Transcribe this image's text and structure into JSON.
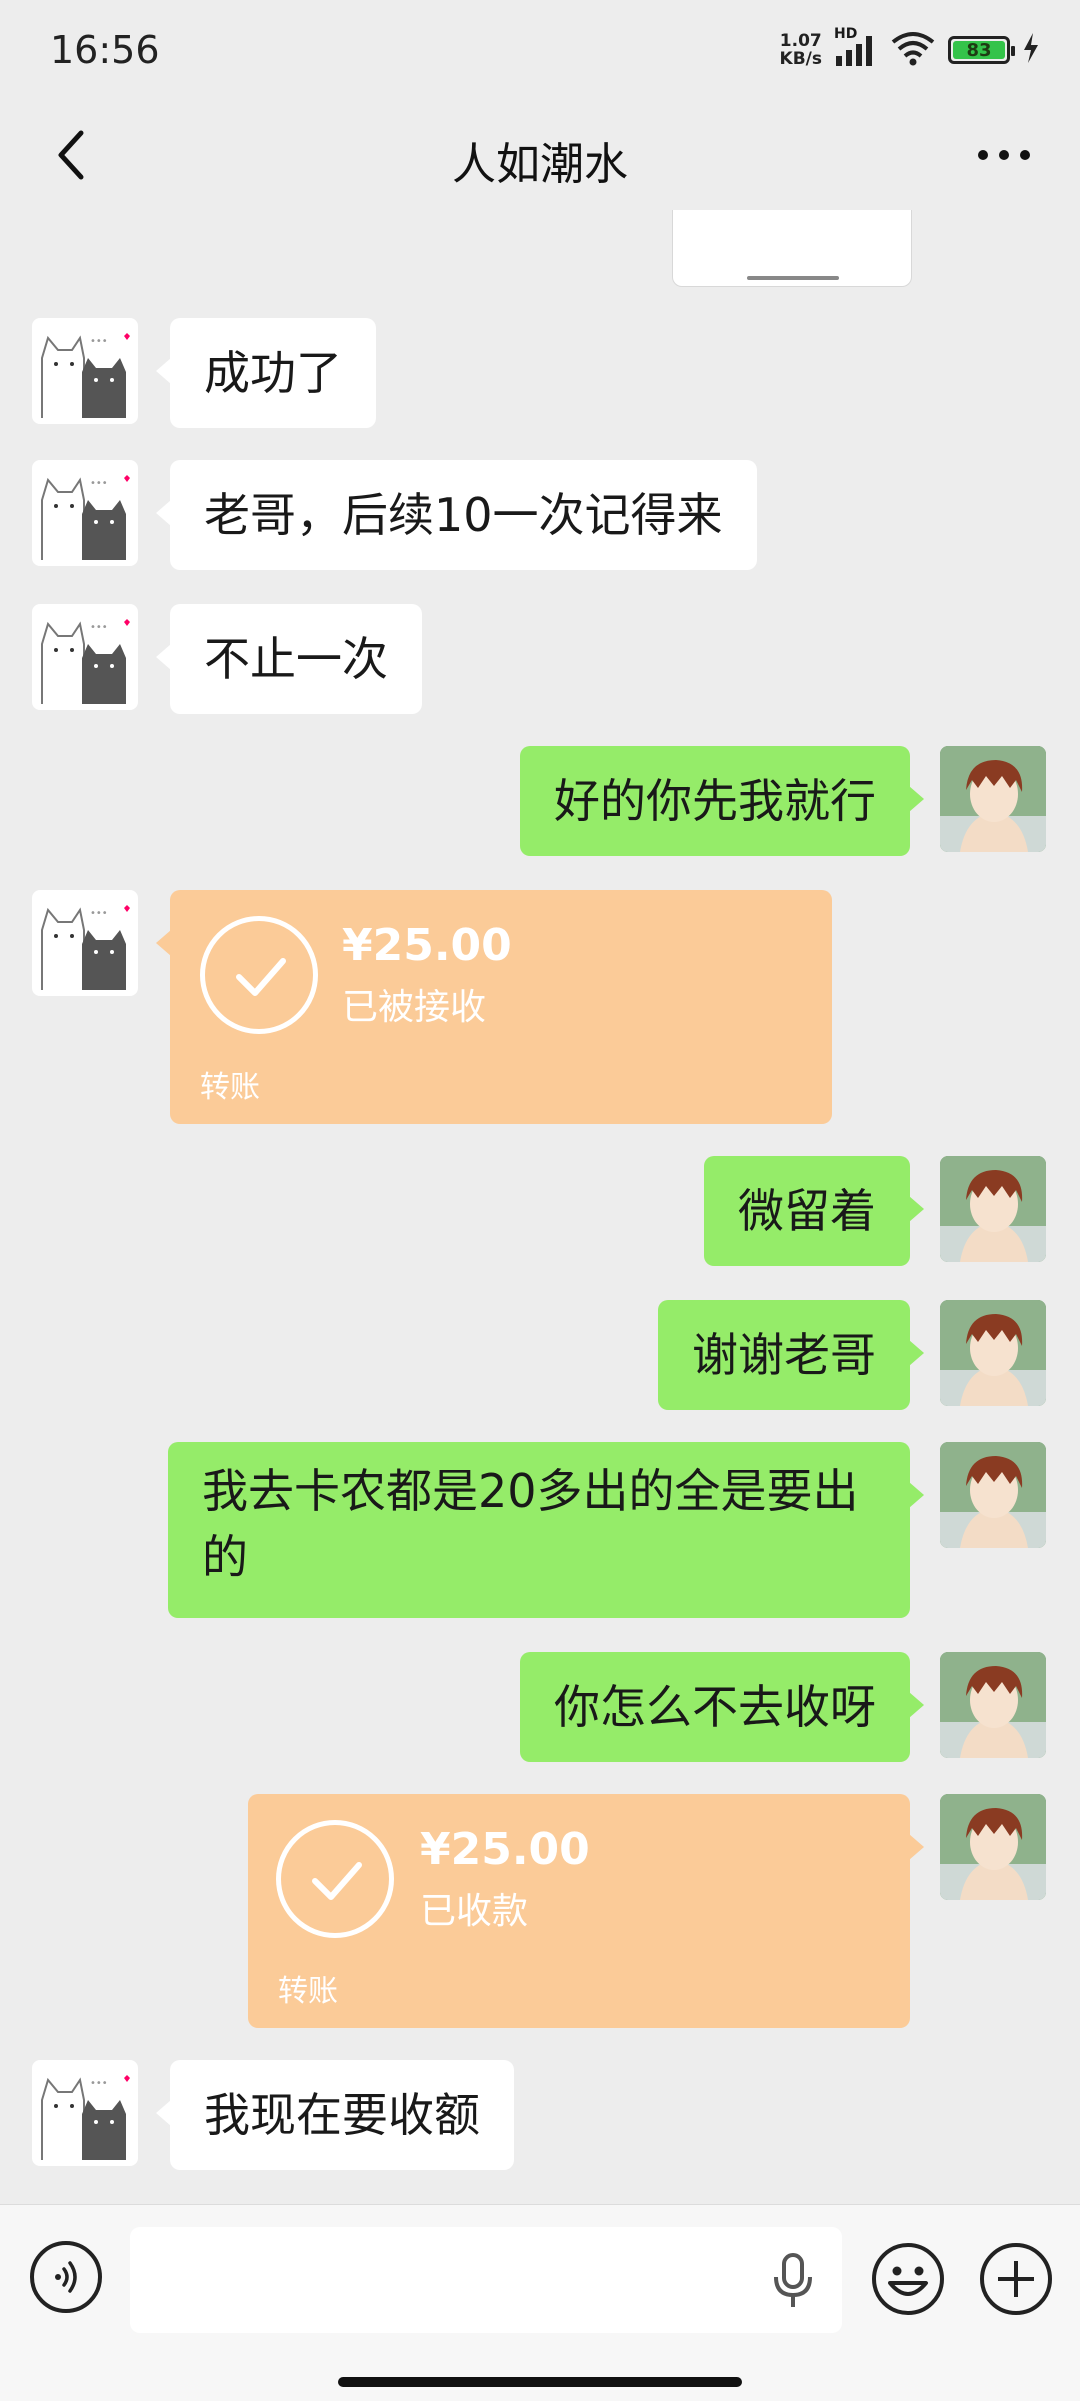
{
  "status_bar": {
    "time": "16:56",
    "net_speed_value": "1.07",
    "net_speed_unit": "KB/s",
    "network_tag": "HD",
    "battery": "83"
  },
  "header": {
    "title": "人如潮水"
  },
  "messages": [
    {
      "sender": "other",
      "type": "text",
      "text": "成功了"
    },
    {
      "sender": "other",
      "type": "text",
      "text": "老哥，后续10一次记得来"
    },
    {
      "sender": "other",
      "type": "text",
      "text": "不止一次"
    },
    {
      "sender": "me",
      "type": "text",
      "text": "好的你先我就行"
    },
    {
      "sender": "other",
      "type": "transfer",
      "amount": "¥25.00",
      "status": "已被接收",
      "label": "转账"
    },
    {
      "sender": "me",
      "type": "text",
      "text": "微留着"
    },
    {
      "sender": "me",
      "type": "text",
      "text": "谢谢老哥"
    },
    {
      "sender": "me",
      "type": "text",
      "text": "我去卡农都是20多出的全是要出的"
    },
    {
      "sender": "me",
      "type": "text",
      "text": "你怎么不去收呀"
    },
    {
      "sender": "me",
      "type": "transfer",
      "amount": "¥25.00",
      "status": "已收款",
      "label": "转账"
    },
    {
      "sender": "other",
      "type": "text",
      "text": "我现在要收额"
    }
  ],
  "input": {
    "value": "",
    "placeholder": ""
  },
  "colors": {
    "background": "#ededed",
    "my_bubble": "#95ec69",
    "other_bubble": "#ffffff",
    "transfer_card": "#fbcb98"
  },
  "icons": {
    "back": "chevron-left-icon",
    "more": "more-dots-icon",
    "voice": "voice-icon",
    "mic": "mic-icon",
    "emoji": "emoji-icon",
    "plus": "plus-icon"
  }
}
